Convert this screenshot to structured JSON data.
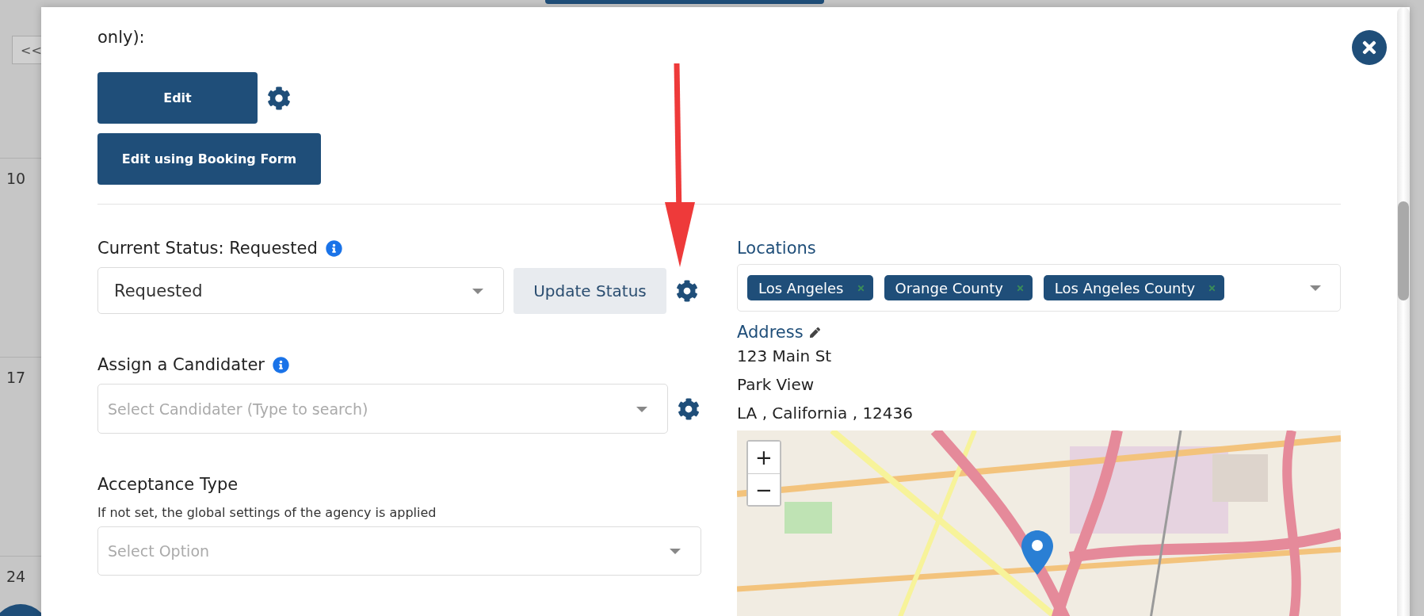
{
  "background": {
    "nav_button": "<<",
    "week_rows": [
      "10",
      "17",
      "24"
    ]
  },
  "modal": {
    "admin_label": "only):",
    "edit_button": "Edit",
    "booking_button": "Edit using Booking Form",
    "status": {
      "label": "Current Status: Requested",
      "value": "Requested",
      "update_button": "Update Status"
    },
    "candidate": {
      "label": "Assign a Candidater",
      "placeholder": "Select Candidater (Type to search)"
    },
    "acceptance": {
      "label": "Acceptance Type",
      "hint": "If not set, the global settings of the agency is applied",
      "placeholder": "Select Option"
    },
    "locations": {
      "label": "Locations",
      "tags": [
        "Los Angeles",
        "Orange County",
        "Los Angeles County"
      ]
    },
    "address": {
      "label": "Address",
      "lines": [
        "123 Main St",
        "Park View",
        "LA , California , 12436"
      ]
    },
    "map": {
      "zoom_in": "+",
      "zoom_out": "−"
    }
  }
}
